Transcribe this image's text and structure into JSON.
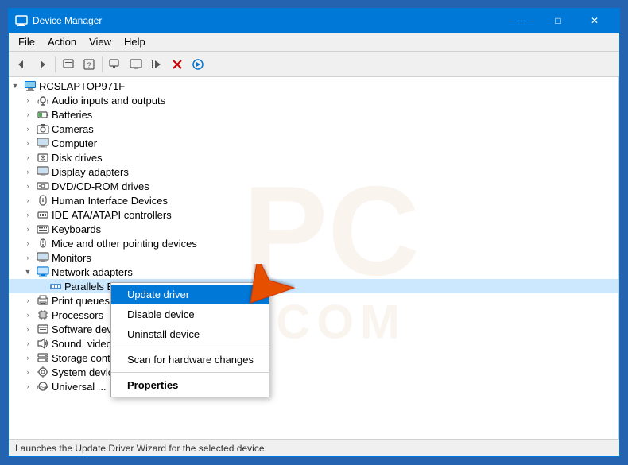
{
  "window": {
    "title": "Device Manager",
    "icon": "🖥"
  },
  "titlebar": {
    "minimize_label": "─",
    "maximize_label": "□",
    "close_label": "✕"
  },
  "menu": {
    "items": [
      "File",
      "Action",
      "View",
      "Help"
    ]
  },
  "toolbar": {
    "buttons": [
      "←",
      "→",
      "⬜",
      "⊡",
      "?",
      "⊞",
      "🖥",
      "🔊",
      "✕",
      "⬇"
    ]
  },
  "tree": {
    "root": "RCSLAPTOP971F",
    "items": [
      {
        "label": "Audio inputs and outputs",
        "icon": "🔊",
        "indent": 1,
        "type": "audio"
      },
      {
        "label": "Batteries",
        "icon": "🔋",
        "indent": 1,
        "type": "battery"
      },
      {
        "label": "Cameras",
        "icon": "📷",
        "indent": 1,
        "type": "camera"
      },
      {
        "label": "Computer",
        "icon": "🖥",
        "indent": 1,
        "type": "computer"
      },
      {
        "label": "Disk drives",
        "icon": "💽",
        "indent": 1,
        "type": "disk"
      },
      {
        "label": "Display adapters",
        "icon": "🖥",
        "indent": 1,
        "type": "display"
      },
      {
        "label": "DVD/CD-ROM drives",
        "icon": "💿",
        "indent": 1,
        "type": "dvd"
      },
      {
        "label": "Human Interface Devices",
        "icon": "🕹",
        "indent": 1,
        "type": "hid"
      },
      {
        "label": "IDE ATA/ATAPI controllers",
        "icon": "⚙",
        "indent": 1,
        "type": "ide"
      },
      {
        "label": "Keyboards",
        "icon": "⌨",
        "indent": 1,
        "type": "keyboard"
      },
      {
        "label": "Mice and other pointing devices",
        "icon": "🖱",
        "indent": 1,
        "type": "mouse"
      },
      {
        "label": "Monitors",
        "icon": "🖥",
        "indent": 1,
        "type": "monitor"
      },
      {
        "label": "Network adapters",
        "icon": "🌐",
        "indent": 1,
        "type": "network",
        "expanded": true
      },
      {
        "label": "Parallels Ethernet Adapter",
        "icon": "🔌",
        "indent": 2,
        "type": "adapter",
        "selected": true
      },
      {
        "label": "Print queues",
        "icon": "🖨",
        "indent": 1,
        "type": "printer"
      },
      {
        "label": "Processors",
        "icon": "⚙",
        "indent": 1,
        "type": "processor"
      },
      {
        "label": "Software devices",
        "icon": "📦",
        "indent": 1,
        "type": "software"
      },
      {
        "label": "Sound, video and game controllers",
        "icon": "🔊",
        "indent": 1,
        "type": "sound"
      },
      {
        "label": "Storage controllers",
        "icon": "💾",
        "indent": 1,
        "type": "storage"
      },
      {
        "label": "System devices",
        "icon": "⚙",
        "indent": 1,
        "type": "system"
      },
      {
        "label": "Universal ...",
        "icon": "🔌",
        "indent": 1,
        "type": "usb"
      }
    ]
  },
  "context_menu": {
    "items": [
      {
        "label": "Update driver",
        "bold": false,
        "highlighted": true
      },
      {
        "label": "Disable device",
        "bold": false
      },
      {
        "label": "Uninstall device",
        "bold": false
      },
      {
        "label": "---"
      },
      {
        "label": "Scan for hardware changes",
        "bold": false
      },
      {
        "label": "---"
      },
      {
        "label": "Properties",
        "bold": true
      }
    ]
  },
  "status_bar": {
    "text": "Launches the Update Driver Wizard for the selected device."
  }
}
